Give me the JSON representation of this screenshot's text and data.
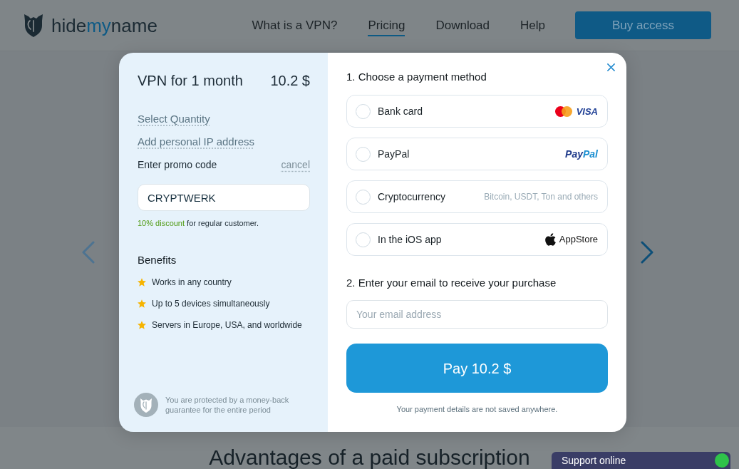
{
  "header": {
    "logo": [
      {
        "text": "hide",
        "accent": false
      },
      {
        "text": "my",
        "accent": true
      },
      {
        "text": "name",
        "accent": false
      }
    ],
    "nav": [
      {
        "label": "What is a VPN?",
        "selected": false
      },
      {
        "label": "Pricing",
        "selected": true
      },
      {
        "label": "Download",
        "selected": false
      },
      {
        "label": "Help",
        "selected": false
      }
    ],
    "cta": "Buy access"
  },
  "carousel": {
    "arrows": [
      {
        "kind": "prev",
        "disabled": true
      },
      {
        "kind": "next",
        "disabled": false
      }
    ]
  },
  "section_heading": "Advantages of a paid subscription",
  "support_chat": {
    "label": "Support online",
    "online": true
  },
  "modal": {
    "order": {
      "product": "VPN for 1 month",
      "price": "10.2 $",
      "links": [
        "Select Quantity",
        "Add personal IP address"
      ],
      "promo": {
        "label": "Enter promo code",
        "cancel": "cancel",
        "value": "CRYPTWERK",
        "discount": "10% discount",
        "discount_note": "for regular customer."
      },
      "benefits": {
        "title": "Benefits",
        "items": [
          "Works in any country",
          "Up to 5 devices simultaneously",
          "Servers in Europe, USA, and worldwide"
        ]
      },
      "guarantee": "You are protected by a money-back guarantee for the entire period"
    },
    "payment": {
      "step1": "1. Choose a payment method",
      "methods": [
        {
          "kind": "card",
          "label": "Bank card",
          "selected": false,
          "badge": "VISA"
        },
        {
          "kind": "paypal",
          "label": "PayPal",
          "selected": false,
          "brand": [
            "Pay",
            "Pal"
          ]
        },
        {
          "kind": "crypto",
          "label": "Cryptocurrency",
          "selected": false,
          "note": "Bitcoin, USDT, Ton and others"
        },
        {
          "kind": "appstore",
          "label": "In the iOS app",
          "selected": false,
          "badge": "AppStore"
        }
      ],
      "step2": "2. Enter your email to receive your purchase",
      "email_placeholder": "Your email address",
      "pay_button": "Pay 10.2 $",
      "privacy_note": "Your payment details are not saved anywhere."
    }
  }
}
